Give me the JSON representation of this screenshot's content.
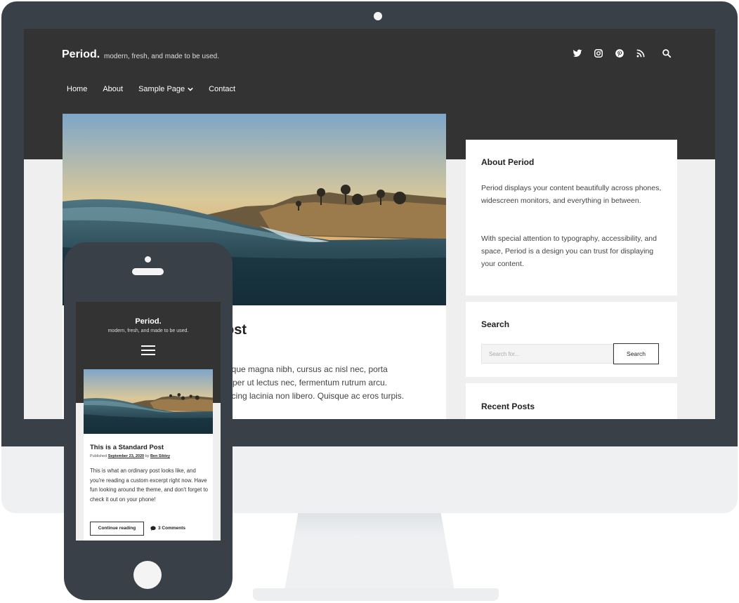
{
  "desktop": {
    "site_title": "Period.",
    "tagline": "modern, fresh, and made to be used.",
    "social_icons": [
      "twitter-icon",
      "instagram-icon",
      "pinterest-icon",
      "rss-icon",
      "search-icon"
    ],
    "nav": {
      "items": [
        {
          "label": "Home"
        },
        {
          "label": "About"
        },
        {
          "label": "Sample Page",
          "has_dropdown": true
        },
        {
          "label": "Contact"
        }
      ]
    },
    "post": {
      "title_partial": "ost",
      "excerpt_lines": [
        "isque magna nibh, cursus ac nisl nec, porta",
        "mper ut lectus nec, fermentum rutrum arcu.",
        "iscing lacinia non libero. Quisque ac eros turpis."
      ]
    },
    "widgets": {
      "about": {
        "title": "About Period",
        "paragraph1": "Period displays your content beautifully across phones, widescreen monitors, and everything in between.",
        "paragraph2": "With special attention to typography, accessibility, and space, Period is a design you can trust for displaying your content."
      },
      "search": {
        "title": "Search",
        "placeholder": "Search for...",
        "button_label": "Search"
      },
      "recent": {
        "title": "Recent Posts"
      }
    }
  },
  "mobile": {
    "site_title": "Period.",
    "tagline": "modern, fresh, and made to be used.",
    "post": {
      "title": "This is a Standard Post",
      "meta_prefix": "Published",
      "date": "September 23, 2020",
      "meta_by": "by",
      "author": "Ben Sibley",
      "excerpt": "This is what an ordinary post looks like, and you're reading a custom excerpt right now. Have fun looking around the theme, and don't forget to check it out on your phone!",
      "continue_label": "Continue reading",
      "comments_label": "3 Comments"
    }
  },
  "colors": {
    "device_frame": "#394048",
    "header_dark": "#333333",
    "page_bg": "#efefef"
  }
}
